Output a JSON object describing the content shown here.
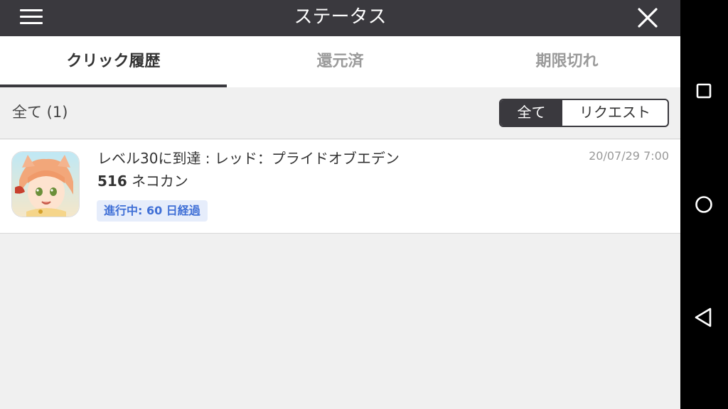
{
  "header": {
    "title": "ステータス",
    "menu_icon": "hamburger-menu-icon",
    "close_icon": "close-icon"
  },
  "tabs": [
    {
      "label": "クリック履歴",
      "active": true
    },
    {
      "label": "還元済",
      "active": false
    },
    {
      "label": "期限切れ",
      "active": false
    }
  ],
  "filter": {
    "count_label": "全て (1)",
    "options": [
      "全て",
      "リクエスト"
    ],
    "selected": "全て"
  },
  "items": [
    {
      "title": "レベル30に到達 : レッド：プライドオブエデン",
      "date": "20/07/29 7:00",
      "reward_amount": "516",
      "reward_unit": " ネコカン",
      "status": "進行中: 60 日経過",
      "icon": "app-icon"
    }
  ],
  "navbar": {
    "icons": [
      "recent-apps-icon",
      "home-icon",
      "back-icon"
    ]
  },
  "colors": {
    "header_bg": "#3a393e",
    "accent_blue": "#3f6fd6",
    "badge_bg": "#e6edfb",
    "page_bg": "#f0f0f0"
  }
}
